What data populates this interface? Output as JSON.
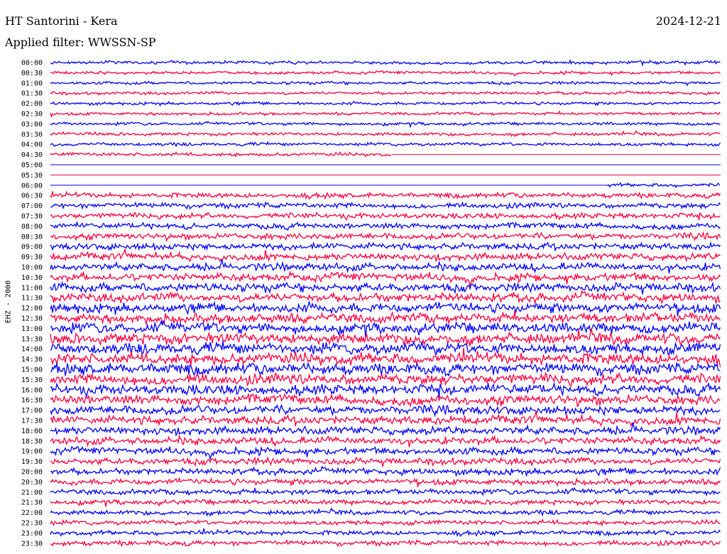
{
  "header": {
    "station": "HT Santorini - Kera",
    "date": "2024-12-21",
    "filter": "Applied filter: WWSSN-SP",
    "channel": "EHZ - 2000"
  },
  "chart_data": {
    "type": "line",
    "title": "HT Santorini - Kera",
    "xlabel": "",
    "ylabel": "EHZ - 2000",
    "grid": false,
    "legend": "none",
    "colors": [
      "#0000ff",
      "#ff0040"
    ],
    "categories": [
      "00:00",
      "00:30",
      "01:00",
      "01:30",
      "02:00",
      "02:30",
      "03:00",
      "03:30",
      "04:00",
      "04:30",
      "05:00",
      "05:30",
      "06:00",
      "06:30",
      "07:00",
      "07:30",
      "08:00",
      "08:30",
      "09:00",
      "09:30",
      "10:00",
      "10:30",
      "11:00",
      "11:30",
      "12:00",
      "12:30",
      "13:00",
      "13:30",
      "14:00",
      "14:30",
      "15:00",
      "15:30",
      "16:00",
      "16:30",
      "17:00",
      "17:30",
      "18:00",
      "18:30",
      "19:00",
      "19:30",
      "20:00",
      "20:30",
      "21:00",
      "21:30",
      "22:00",
      "22:30",
      "23:00",
      "23:30"
    ],
    "rows": [
      {
        "label": "00:00",
        "amplitude": 0.35,
        "coverage": [
          0,
          1
        ]
      },
      {
        "label": "00:30",
        "amplitude": 0.33,
        "coverage": [
          0,
          1
        ]
      },
      {
        "label": "01:00",
        "amplitude": 0.33,
        "coverage": [
          0,
          1
        ]
      },
      {
        "label": "01:30",
        "amplitude": 0.33,
        "coverage": [
          0,
          1
        ]
      },
      {
        "label": "02:00",
        "amplitude": 0.33,
        "coverage": [
          0,
          1
        ]
      },
      {
        "label": "02:30",
        "amplitude": 0.33,
        "coverage": [
          0,
          1
        ]
      },
      {
        "label": "03:00",
        "amplitude": 0.34,
        "coverage": [
          0,
          1
        ]
      },
      {
        "label": "03:30",
        "amplitude": 0.35,
        "coverage": [
          0,
          1
        ]
      },
      {
        "label": "04:00",
        "amplitude": 0.36,
        "coverage": [
          0,
          1
        ]
      },
      {
        "label": "04:30",
        "amplitude": 0.38,
        "coverage": [
          0,
          0.51
        ]
      },
      {
        "label": "05:00",
        "amplitude": 0,
        "coverage": [
          0,
          0
        ]
      },
      {
        "label": "05:30",
        "amplitude": 0,
        "coverage": [
          0,
          0
        ]
      },
      {
        "label": "06:00",
        "amplitude": 0.4,
        "coverage": [
          0.83,
          1
        ]
      },
      {
        "label": "06:30",
        "amplitude": 0.55,
        "coverage": [
          0,
          1
        ]
      },
      {
        "label": "07:00",
        "amplitude": 0.6,
        "coverage": [
          0,
          1
        ]
      },
      {
        "label": "07:30",
        "amplitude": 0.62,
        "coverage": [
          0,
          1
        ]
      },
      {
        "label": "08:00",
        "amplitude": 0.65,
        "coverage": [
          0,
          1
        ]
      },
      {
        "label": "08:30",
        "amplitude": 0.7,
        "coverage": [
          0,
          1
        ]
      },
      {
        "label": "09:00",
        "amplitude": 0.75,
        "coverage": [
          0,
          1
        ]
      },
      {
        "label": "09:30",
        "amplitude": 0.8,
        "coverage": [
          0,
          1
        ]
      },
      {
        "label": "10:00",
        "amplitude": 0.85,
        "coverage": [
          0,
          1
        ]
      },
      {
        "label": "10:30",
        "amplitude": 0.9,
        "coverage": [
          0,
          1
        ]
      },
      {
        "label": "11:00",
        "amplitude": 0.95,
        "coverage": [
          0,
          1
        ]
      },
      {
        "label": "11:30",
        "amplitude": 1.0,
        "coverage": [
          0,
          1
        ]
      },
      {
        "label": "12:00",
        "amplitude": 1.05,
        "coverage": [
          0,
          1
        ]
      },
      {
        "label": "12:30",
        "amplitude": 1.1,
        "coverage": [
          0,
          1
        ]
      },
      {
        "label": "13:00",
        "amplitude": 1.15,
        "coverage": [
          0,
          1
        ]
      },
      {
        "label": "13:30",
        "amplitude": 1.2,
        "coverage": [
          0,
          1
        ]
      },
      {
        "label": "14:00",
        "amplitude": 1.25,
        "coverage": [
          0,
          1
        ]
      },
      {
        "label": "14:30",
        "amplitude": 1.25,
        "coverage": [
          0,
          1
        ]
      },
      {
        "label": "15:00",
        "amplitude": 1.25,
        "coverage": [
          0,
          1
        ]
      },
      {
        "label": "15:30",
        "amplitude": 1.2,
        "coverage": [
          0,
          1
        ]
      },
      {
        "label": "16:00",
        "amplitude": 1.15,
        "coverage": [
          0,
          1
        ]
      },
      {
        "label": "16:30",
        "amplitude": 1.1,
        "coverage": [
          0,
          1
        ]
      },
      {
        "label": "17:00",
        "amplitude": 1.0,
        "coverage": [
          0,
          1
        ]
      },
      {
        "label": "17:30",
        "amplitude": 0.95,
        "coverage": [
          0,
          1
        ]
      },
      {
        "label": "18:00",
        "amplitude": 0.9,
        "coverage": [
          0,
          1
        ]
      },
      {
        "label": "18:30",
        "amplitude": 0.85,
        "coverage": [
          0,
          1
        ]
      },
      {
        "label": "19:00",
        "amplitude": 0.8,
        "coverage": [
          0,
          1
        ]
      },
      {
        "label": "19:30",
        "amplitude": 0.75,
        "coverage": [
          0,
          1
        ]
      },
      {
        "label": "20:00",
        "amplitude": 0.7,
        "coverage": [
          0,
          1
        ]
      },
      {
        "label": "20:30",
        "amplitude": 0.65,
        "coverage": [
          0,
          1
        ]
      },
      {
        "label": "21:00",
        "amplitude": 0.6,
        "coverage": [
          0,
          1
        ]
      },
      {
        "label": "21:30",
        "amplitude": 0.55,
        "coverage": [
          0,
          1
        ]
      },
      {
        "label": "22:00",
        "amplitude": 0.5,
        "coverage": [
          0,
          1
        ]
      },
      {
        "label": "22:30",
        "amplitude": 0.5,
        "coverage": [
          0,
          1
        ]
      },
      {
        "label": "23:00",
        "amplitude": 0.5,
        "coverage": [
          0,
          1
        ]
      },
      {
        "label": "23:30",
        "amplitude": 0.55,
        "coverage": [
          0,
          1
        ]
      }
    ],
    "flat_lines": [
      "04:30",
      "05:00",
      "05:30",
      "06:00"
    ]
  }
}
